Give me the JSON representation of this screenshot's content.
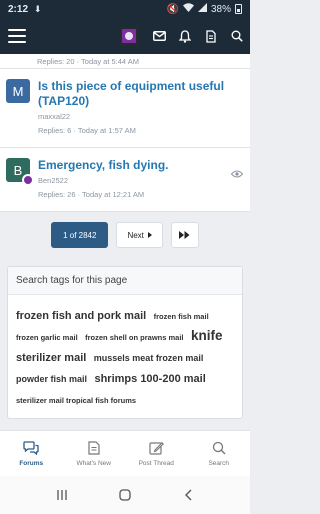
{
  "status_bar": {
    "time": "2:12",
    "battery": "38%"
  },
  "app_bar": {
    "icons": [
      "menu-icon",
      "site-logo",
      "mail-icon",
      "bell-icon",
      "document-icon",
      "search-icon"
    ]
  },
  "threads": {
    "partial_meta": "Replies: 20 · Today at 5:44 AM",
    "items": [
      {
        "avatar_letter": "M",
        "avatar_color": "#3b6aa0",
        "title": "Is this piece of equipment useful (TAP120)",
        "author": "maxxal22",
        "meta": "Replies: 6 · Today at 1:57 AM"
      },
      {
        "avatar_letter": "B",
        "avatar_color": "#2f6b5e",
        "title": "Emergency, fish dying.",
        "author": "Ben2522",
        "meta": "Replies: 26 · Today at 12:21 AM"
      }
    ]
  },
  "pagination": {
    "current": "1 of 2842",
    "next": "Next"
  },
  "tags": {
    "heading": "Search tags for this page",
    "items": [
      {
        "text": "frozen fish and pork mail",
        "size": 3
      },
      {
        "text": "frozen fish mail",
        "size": 1
      },
      {
        "text": "frozen garlic mail",
        "size": 1
      },
      {
        "text": "frozen shell on prawns mail",
        "size": 1
      },
      {
        "text": "knife",
        "size": 4
      },
      {
        "text": "sterilizer mail",
        "size": 3
      },
      {
        "text": "mussels meat frozen mail",
        "size": 2
      },
      {
        "text": "powder fish mail",
        "size": 2
      },
      {
        "text": "shrimps 100-200 mail",
        "size": 3
      },
      {
        "text": "sterilizer mail tropical fish forums",
        "size": 1
      }
    ]
  },
  "bottom_nav": [
    {
      "label": "Forums",
      "icon": "forums-icon",
      "active": true
    },
    {
      "label": "What's New",
      "icon": "whats-new-icon",
      "active": false
    },
    {
      "label": "Post Thread",
      "icon": "post-thread-icon",
      "active": false
    },
    {
      "label": "Search",
      "icon": "search-icon",
      "active": false
    }
  ],
  "colors": {
    "header": "#1d2a38",
    "link": "#2577b1",
    "accent": "#2c5b86"
  }
}
